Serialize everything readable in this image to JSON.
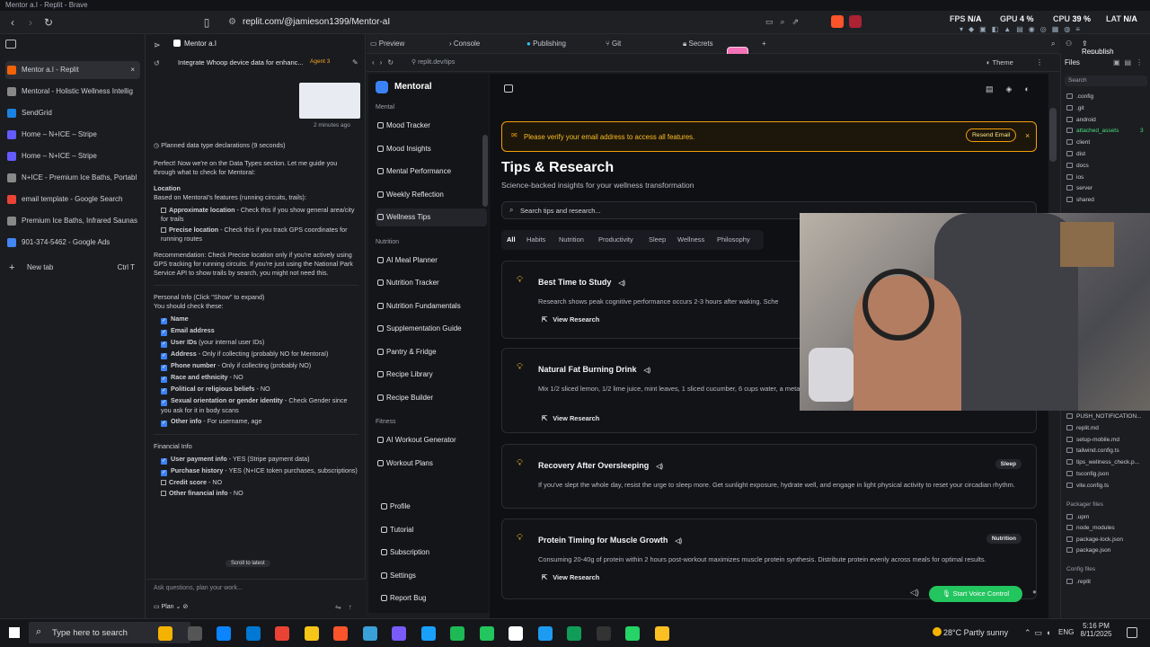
{
  "window_title": "Mentor a.I - Replit - Brave",
  "browser": {
    "url": "replit.com/@jamieson1399/Mentor-aI",
    "stats": [
      {
        "label": "FPS",
        "value": "N/A"
      },
      {
        "label": "GPU",
        "value": "4 %"
      },
      {
        "label": "CPU",
        "value": "39 %"
      },
      {
        "label": "LAT",
        "value": "N/A"
      }
    ]
  },
  "tabs": [
    {
      "title": "Mentor a.I - Replit",
      "color": "#f26207",
      "active": true
    },
    {
      "title": "Mentoral - Holistic Wellness Intellig",
      "color": "#888888"
    },
    {
      "title": "SendGrid",
      "color": "#1a82e2"
    },
    {
      "title": "Home – N+ICE – Stripe",
      "color": "#635bff"
    },
    {
      "title": "Home – N+ICE – Stripe",
      "color": "#635bff"
    },
    {
      "title": "N+ICE - Premium Ice Baths, Portabl",
      "color": "#888888"
    },
    {
      "title": "email template - Google Search",
      "color": "#ea4335"
    },
    {
      "title": "Premium Ice Baths, Infrared Saunas",
      "color": "#888888"
    },
    {
      "title": "901-374-5462 - Google Ads",
      "color": "#4285f4"
    }
  ],
  "new_tab": {
    "label": "New tab",
    "shortcut": "Ctrl T"
  },
  "replit": {
    "project": "Mentor a.I",
    "chat_title": "Integrate Whoop device data for enhanc...",
    "agent_badge": "Agent 3",
    "timestamp": "2 minutes ago",
    "planned": "Planned data type declarations (9 seconds)",
    "intro": "Perfect! Now we're on the Data Types section. Let me guide you through what to check for MentoraI:",
    "location_heading": "Location",
    "location_sub": "Based on MentoraI's features (running circuits, trails):",
    "loc_items": [
      {
        "b": "Approximate location",
        "t": " - Check this if you show general area/city for trails"
      },
      {
        "b": "Precise location",
        "t": " - Check this if you track GPS coordinates for running routes"
      }
    ],
    "recommendation": "Recommendation: Check Precise location only if you're actively using GPS tracking for running circuits. If you're just using the National Park Service API to show trails by search, you might not need this.",
    "personal_heading": "Personal Info (Click \"Show\" to expand)",
    "personal_sub": "You should check these:",
    "personal_items": [
      {
        "b": "Name",
        "t": ""
      },
      {
        "b": "Email address",
        "t": ""
      },
      {
        "b": "User IDs",
        "t": " (your internal user IDs)"
      },
      {
        "b": "Address",
        "t": " - Only if collecting (probably NO for MentoraI)"
      },
      {
        "b": "Phone number",
        "t": " - Only if collecting (probably NO)"
      },
      {
        "b": "Race and ethnicity",
        "t": " - NO"
      },
      {
        "b": "Political or religious beliefs",
        "t": " - NO"
      },
      {
        "b": "Sexual orientation or gender identity",
        "t": " - Check Gender since you ask for it in body scans"
      },
      {
        "b": "Other info",
        "t": " - For username, age"
      }
    ],
    "financial_heading": "Financial Info",
    "financial_items": [
      {
        "b": "User payment info",
        "t": " - YES (Stripe payment data)"
      },
      {
        "b": "Purchase history",
        "t": " - YES (N+ICE token purchases, subscriptions)"
      },
      {
        "b": "Credit score",
        "t": " - NO"
      },
      {
        "b": "Other financial info",
        "t": " - NO"
      }
    ],
    "scroll_latest": "Scroll to latest",
    "input_placeholder": "Ask questions, plan your work...",
    "plan_label": "Plan",
    "workspace_tabs": [
      "Preview",
      "Console",
      "Publishing",
      "Git",
      "Secrets"
    ],
    "preview_url": "replit.dev/tips",
    "theme_label": "Theme",
    "republish": "Republish",
    "files_title": "Files",
    "files_search": "Search",
    "files": [
      ".config",
      ".git",
      "android",
      "attached_assets",
      "client",
      "dist",
      "docs",
      "ios",
      "server",
      "shared",
      "PUSH_NOTIFICATION...",
      "replit.md",
      "setup-mobile.md",
      "tailwind.config.ts",
      "tips_wellness_check.p...",
      "tsconfig.json",
      "vite.config.ts"
    ],
    "attached_count": "3",
    "packager_heading": "Packager files",
    "packager_files": [
      ".upm",
      "node_modules",
      "package-lock.json",
      "package.json"
    ],
    "config_heading": "Config files",
    "config_files": [
      ".replit"
    ]
  },
  "app": {
    "brand": "Mentoral",
    "sections": [
      {
        "title": "Mental",
        "items": [
          "Mood Tracker",
          "Mood Insights",
          "Mental Performance",
          "Weekly Reflection",
          "Wellness Tips"
        ]
      },
      {
        "title": "Nutrition",
        "items": [
          "AI Meal Planner",
          "Nutrition Tracker",
          "Nutrition Fundamentals",
          "Supplementation Guide",
          "Pantry & Fridge",
          "Recipe Library",
          "Recipe Builder"
        ]
      },
      {
        "title": "Fitness",
        "items": [
          "AI Workout Generator",
          "Workout Plans"
        ]
      }
    ],
    "bottom_items": [
      "Profile",
      "Tutorial",
      "Subscription",
      "Settings",
      "Report Bug"
    ],
    "alert": "Please verify your email address to access all features.",
    "resend": "Resend Email",
    "page_title": "Tips & Research",
    "page_subtitle": "Science-backed insights for your wellness transformation",
    "search_placeholder": "Search tips and research...",
    "filters": [
      "All",
      "Habits",
      "Nutrition",
      "Productivity",
      "Sleep",
      "Wellness",
      "Philosophy"
    ],
    "cards": [
      {
        "title": "Best Time to Study",
        "desc": "Research shows peak cognitive performance occurs 2-3 hours after waking. Sche",
        "link": "View Research",
        "badge": ""
      },
      {
        "title": "Natural Fat Burning Drink",
        "desc": "Mix 1/2 sliced lemon, 1/2 lime juice, mint leaves, 1 sliced cucumber, 6 cups water, a metabolism.",
        "link": "View Research",
        "badge": ""
      },
      {
        "title": "Recovery After Oversleeping",
        "desc": "If you've slept the whole day, resist the urge to sleep more. Get sunlight exposure, hydrate well, and engage in light physical activity to reset your circadian rhythm.",
        "link": "",
        "badge": "Sleep"
      },
      {
        "title": "Protein Timing for Muscle Growth",
        "desc": "Consuming 20-40g of protein within 2 hours post-workout maximizes muscle protein synthesis. Distribute protein evenly across meals for optimal results.",
        "link": "View Research",
        "badge": "Nutrition"
      }
    ],
    "voice": "Start Voice Control"
  },
  "taskbar": {
    "search": "Type here to search",
    "weather": "28°C  Partly sunny",
    "lang": "ENG",
    "time": "5:16 PM",
    "date": "8/11/2025"
  }
}
